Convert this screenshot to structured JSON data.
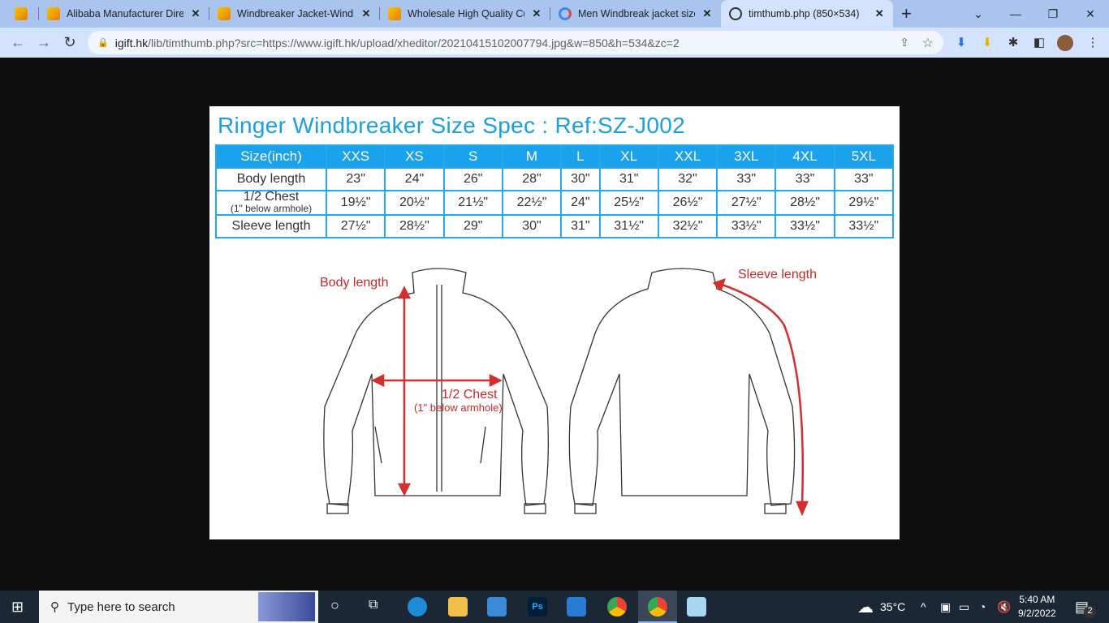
{
  "browser": {
    "tabs": [
      {
        "title": "Alibaba Manufacturer Direc",
        "icon": "alibaba-icon"
      },
      {
        "title": "Windbreaker Jacket-Windb",
        "icon": "alibaba-icon"
      },
      {
        "title": "Wholesale High Quality Cus",
        "icon": "alibaba-icon"
      },
      {
        "title": "Men Windbreak jacket size",
        "icon": "google-icon"
      },
      {
        "title": "timthumb.php (850×534)",
        "icon": "globe-icon",
        "active": true
      }
    ],
    "url_host": "igift.hk",
    "url_path": "/lib/timthumb.php?src=https://www.igift.hk/upload/xheditor/20210415102007794.jpg&w=850&h=534&zc=2"
  },
  "image": {
    "title": "Ringer Windbreaker Size Spec : Ref:SZ-J002",
    "header": [
      "Size(inch)",
      "XXS",
      "XS",
      "S",
      "M",
      "L",
      "XL",
      "XXL",
      "3XL",
      "4XL",
      "5XL"
    ],
    "rows": [
      {
        "label": "Body length",
        "sub": "",
        "values": [
          "23\"",
          "24\"",
          "26\"",
          "28\"",
          "30\"",
          "31\"",
          "32\"",
          "33\"",
          "33\"",
          "33\""
        ]
      },
      {
        "label": "1/2 Chest",
        "sub": "(1\" below armhole)",
        "values": [
          "19½\"",
          "20½\"",
          "21½\"",
          "22½\"",
          "24\"",
          "25½\"",
          "26½\"",
          "27½\"",
          "28½\"",
          "29½\""
        ]
      },
      {
        "label": "Sleeve length",
        "sub": "",
        "values": [
          "27½\"",
          "28½\"",
          "29\"",
          "30\"",
          "31\"",
          "31½\"",
          "32½\"",
          "33½\"",
          "33½\"",
          "33½\""
        ]
      }
    ],
    "annotations": {
      "body_length": "Body length",
      "chest": "1/2 Chest",
      "chest_sub": "(1\" below armhole)",
      "sleeve_length": "Sleeve length"
    }
  },
  "taskbar": {
    "search_placeholder": "Type here to search",
    "weather": "35°C",
    "time": "5:40 AM",
    "date": "9/2/2022",
    "notifications": "2"
  }
}
